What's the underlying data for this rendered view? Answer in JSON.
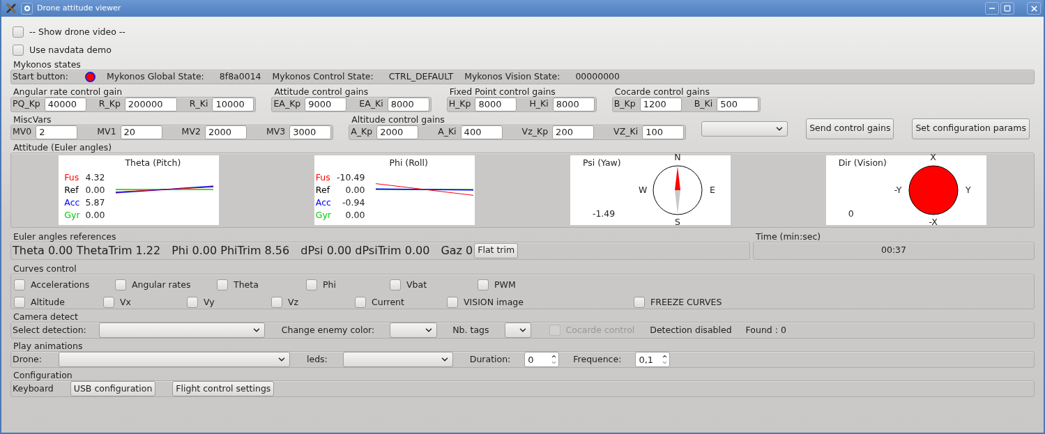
{
  "window": {
    "title": "Drone attitude viewer"
  },
  "options": [
    {
      "label": "-- Show drone video --",
      "checked": false
    },
    {
      "label": "Use navdata demo",
      "checked": false
    }
  ],
  "mykonos_states": {
    "title": "Mykonos states",
    "start_label": "Start button:",
    "items": [
      {
        "label": "Mykonos Global State:",
        "value": "8f8a0014"
      },
      {
        "label": "Mykonos Control State:",
        "value": "CTRL_DEFAULT"
      },
      {
        "label": "Mykonos Vision State:",
        "value": "00000000"
      }
    ]
  },
  "gain_rows": [
    [
      {
        "title": "Angular rate control gain",
        "fields": [
          {
            "label": "PQ_Kp",
            "value": "40000"
          },
          {
            "label": "R_Kp",
            "value": "200000"
          },
          {
            "label": "R_Ki",
            "value": "10000"
          }
        ]
      },
      {
        "title": "Attitude control gains",
        "fields": [
          {
            "label": "EA_Kp",
            "value": "9000"
          },
          {
            "label": "EA_Ki",
            "value": "8000"
          }
        ]
      },
      {
        "title": "Fixed Point control gains",
        "fields": [
          {
            "label": "H_Kp",
            "value": "8000"
          },
          {
            "label": "H_Ki",
            "value": "8000"
          }
        ]
      },
      {
        "title": "Cocarde control gains",
        "fields": [
          {
            "label": "B_Kp",
            "value": "1200"
          },
          {
            "label": "B_Ki",
            "value": "500"
          }
        ]
      }
    ],
    [
      {
        "title": "MiscVars",
        "fields": [
          {
            "label": "MV0",
            "value": "2"
          },
          {
            "label": "MV1",
            "value": "20"
          },
          {
            "label": "MV2",
            "value": "2000"
          },
          {
            "label": "MV3",
            "value": "3000"
          }
        ]
      },
      {
        "title": "Altitude control gains",
        "fields": [
          {
            "label": "A_Kp",
            "value": "2000"
          },
          {
            "label": "A_Ki",
            "value": "400"
          },
          {
            "label": "Vz_Kp",
            "value": "200"
          },
          {
            "label": "VZ_Ki",
            "value": "100"
          }
        ]
      }
    ]
  ],
  "buttons": [
    "Send control gains",
    "Set configuration params"
  ],
  "attitude": {
    "title": "Attitude (Euler angles)",
    "plots": [
      {
        "kind": "graph",
        "title": "Theta (Pitch)",
        "readings": [
          {
            "label": "Fus",
            "value": "4.32",
            "color": "#ff0000"
          },
          {
            "label": "Ref",
            "value": "0.00",
            "color": "#000000"
          },
          {
            "label": "Acc",
            "value": "5.87",
            "color": "#0000ff"
          },
          {
            "label": "Gyr",
            "value": "0.00",
            "color": "#00cc00"
          }
        ]
      },
      {
        "kind": "graph",
        "title": "Phi (Roll)",
        "readings": [
          {
            "label": "Fus",
            "value": "-10.49",
            "color": "#ff0000"
          },
          {
            "label": "Ref",
            "value": "0.00",
            "color": "#000000"
          },
          {
            "label": "Acc",
            "value": "-0.94",
            "color": "#0000ff"
          },
          {
            "label": "Gyr",
            "value": "0.00",
            "color": "#00cc00"
          }
        ]
      },
      {
        "kind": "compass",
        "title": "Psi (Yaw)",
        "value": "-1.49",
        "marks": [
          "N",
          "E",
          "S",
          "W"
        ]
      },
      {
        "kind": "target",
        "title": "Dir (Vision)",
        "value": "0",
        "marks": [
          "X",
          "Y",
          "-X",
          "-Y"
        ]
      }
    ]
  },
  "euler_refs": {
    "title": "Euler angles references",
    "items": [
      "Theta 0.00 ThetaTrim 1.22",
      "Phi 0.00 PhiTrim 8.56",
      "dPsi 0.00 dPsiTrim 0.00",
      "Gaz 0"
    ],
    "button": "Flat trim"
  },
  "time": {
    "title": "Time (min:sec)",
    "value": "00:37"
  },
  "curves": {
    "title": "Curves control",
    "rows": [
      [
        {
          "label": "Accelerations",
          "checked": false
        },
        {
          "label": "Angular rates",
          "checked": false
        },
        {
          "label": "Theta",
          "checked": false
        },
        {
          "label": "Phi",
          "checked": false
        },
        {
          "label": "Vbat",
          "checked": false
        },
        {
          "label": "PWM",
          "checked": false
        }
      ],
      [
        {
          "label": "Altitude",
          "checked": false
        },
        {
          "label": "Vx",
          "checked": false
        },
        {
          "label": "Vy",
          "checked": false
        },
        {
          "label": "Vz",
          "checked": false
        },
        {
          "label": "Current",
          "checked": false
        },
        {
          "label": "VISION image",
          "checked": false
        },
        {
          "label": "FREEZE CURVES",
          "checked": false
        }
      ]
    ]
  },
  "camera_detect": {
    "title": "Camera detect",
    "detection_label": "Select detection:",
    "enemy_color_label": "Change enemy color:",
    "tags_label": "Nb. tags",
    "cocarde": {
      "label": "Cocarde control",
      "checked": false,
      "disabled": true
    },
    "status": "Detection disabled",
    "found": "Found : 0"
  },
  "animations": {
    "title": "Play animations",
    "drone_label": "Drone:",
    "leds_label": "leds:",
    "duration_label": "Duration:",
    "duration_value": "0",
    "frequence_label": "Frequence:",
    "frequence_value": "0,1"
  },
  "configuration": {
    "title": "Configuration",
    "keyboard_label": "Keyboard",
    "buttons": [
      "USB configuration",
      "Flight control settings"
    ]
  }
}
